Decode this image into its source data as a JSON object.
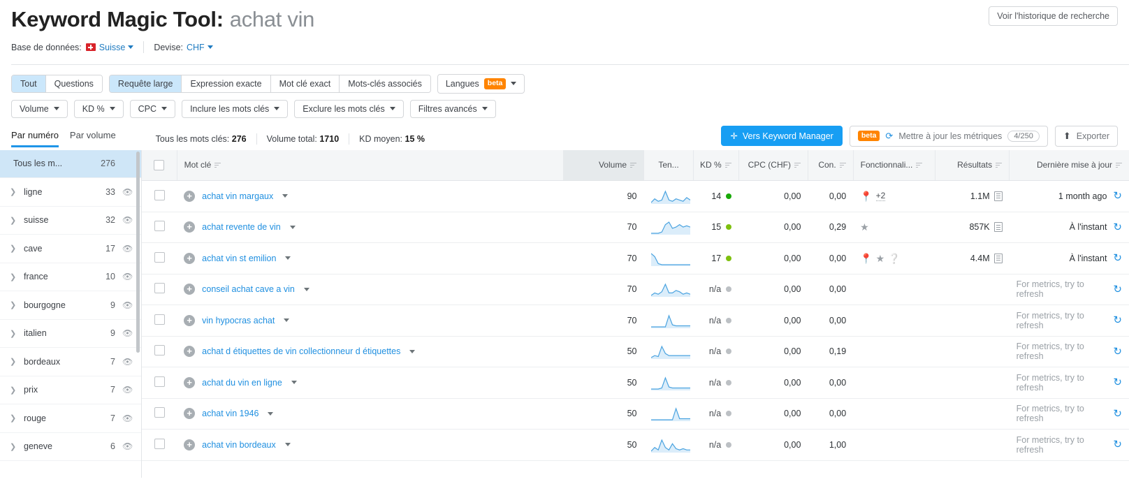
{
  "header": {
    "title_main": "Keyword Magic Tool:",
    "title_query": "achat vin",
    "history_button": "Voir l'historique de recherche",
    "database_label": "Base de données:",
    "database_value": "Suisse",
    "currency_label": "Devise:",
    "currency_value": "CHF"
  },
  "filters": {
    "match_tabs": [
      {
        "label": "Tout",
        "active": true
      },
      {
        "label": "Questions",
        "active": false
      }
    ],
    "type_tabs": [
      {
        "label": "Requête large",
        "active": true
      },
      {
        "label": "Expression exacte",
        "active": false
      },
      {
        "label": "Mot clé exact",
        "active": false
      },
      {
        "label": "Mots-clés associés",
        "active": false
      }
    ],
    "languages": {
      "label": "Langues",
      "badge": "beta"
    },
    "dropdowns": [
      {
        "label": "Volume"
      },
      {
        "label": "KD %"
      },
      {
        "label": "CPC"
      },
      {
        "label": "Inclure les mots clés"
      },
      {
        "label": "Exclure les mots clés"
      },
      {
        "label": "Filtres avancés"
      }
    ]
  },
  "summary": {
    "sort_tabs": [
      {
        "label": "Par numéro",
        "active": true
      },
      {
        "label": "Par volume",
        "active": false
      }
    ],
    "stats": [
      {
        "label": "Tous les mots clés:",
        "value": "276"
      },
      {
        "label": "Volume total:",
        "value": "1710"
      },
      {
        "label": "KD moyen:",
        "value": "15 %"
      }
    ],
    "keyword_manager_button": "Vers Keyword Manager",
    "update_metrics_button": "Mettre à jour les métriques",
    "update_metrics_badge": "beta",
    "update_metrics_quota": "4/250",
    "export_button": "Exporter"
  },
  "sidebar": {
    "all_label": "Tous les m...",
    "all_count": "276",
    "items": [
      {
        "label": "ligne",
        "count": "33"
      },
      {
        "label": "suisse",
        "count": "32"
      },
      {
        "label": "cave",
        "count": "17"
      },
      {
        "label": "france",
        "count": "10"
      },
      {
        "label": "bourgogne",
        "count": "9"
      },
      {
        "label": "italien",
        "count": "9"
      },
      {
        "label": "bordeaux",
        "count": "7"
      },
      {
        "label": "prix",
        "count": "7"
      },
      {
        "label": "rouge",
        "count": "7"
      },
      {
        "label": "geneve",
        "count": "6"
      }
    ]
  },
  "table": {
    "columns": [
      {
        "key": "keyword",
        "label": "Mot clé",
        "align": "left",
        "sortable": true,
        "sorted": false
      },
      {
        "key": "volume",
        "label": "Volume",
        "align": "right",
        "sortable": true,
        "sorted": true
      },
      {
        "key": "trend",
        "label": "Ten...",
        "align": "center",
        "sortable": false,
        "sorted": false
      },
      {
        "key": "kd",
        "label": "KD %",
        "align": "right",
        "sortable": true,
        "sorted": false
      },
      {
        "key": "cpc",
        "label": "CPC (CHF)",
        "align": "right",
        "sortable": true,
        "sorted": false
      },
      {
        "key": "con",
        "label": "Con.",
        "align": "right",
        "sortable": true,
        "sorted": false
      },
      {
        "key": "features",
        "label": "Fonctionnali...",
        "align": "left",
        "sortable": true,
        "sorted": false
      },
      {
        "key": "results",
        "label": "Résultats",
        "align": "right",
        "sortable": true,
        "sorted": false
      },
      {
        "key": "updated",
        "label": "Dernière mise à jour",
        "align": "right",
        "sortable": true,
        "sorted": false
      }
    ],
    "rows": [
      {
        "keyword": "achat vin margaux",
        "volume": "90",
        "trend": "3,6,4,5,12,5,4,6,5,4,7,5",
        "kd": "14",
        "kd_color": "#18a908",
        "cpc": "0,00",
        "con": "0,00",
        "features": [
          "location-pin-icon"
        ],
        "features_more": "+2",
        "results": "1.1M",
        "updated": "1 month ago",
        "updated_muted": false
      },
      {
        "keyword": "achat revente de vin",
        "volume": "70",
        "trend": "2,2,2,3,9,11,6,7,9,7,8,7",
        "kd": "15",
        "kd_color": "#7ec00e",
        "cpc": "0,00",
        "con": "0,29",
        "features": [
          "star-icon"
        ],
        "features_more": "",
        "results": "857K",
        "updated": "À l'instant",
        "updated_muted": false
      },
      {
        "keyword": "achat vin st emilion",
        "volume": "70",
        "trend": "14,11,4,3,3,3,3,3,3,3,3,3",
        "kd": "17",
        "kd_color": "#7ec00e",
        "cpc": "0,00",
        "con": "0,00",
        "features": [
          "location-pin-icon",
          "star-icon",
          "question-icon"
        ],
        "features_more": "",
        "results": "4.4M",
        "updated": "À l'instant",
        "updated_muted": false
      },
      {
        "keyword": "conseil achat cave a vin",
        "volume": "70",
        "trend": "3,5,4,6,12,5,5,7,6,4,5,4",
        "kd": "n/a",
        "kd_color": "#bcc0c4",
        "cpc": "0,00",
        "con": "0,00",
        "features": [],
        "features_more": "",
        "results": "",
        "updated": "For metrics, try to refresh",
        "updated_muted": true
      },
      {
        "keyword": "vin hypocras achat",
        "volume": "70",
        "trend": "2,2,2,2,2,13,4,3,3,3,3,3",
        "kd": "n/a",
        "kd_color": "#bcc0c4",
        "cpc": "0,00",
        "con": "0,00",
        "features": [],
        "features_more": "",
        "results": "",
        "updated": "For metrics, try to refresh",
        "updated_muted": true
      },
      {
        "keyword": "achat d étiquettes de vin collectionneur d étiquettes",
        "volume": "50",
        "trend": "2,4,3,13,6,4,4,4,4,4,4,4",
        "kd": "n/a",
        "kd_color": "#bcc0c4",
        "cpc": "0,00",
        "con": "0,19",
        "features": [],
        "features_more": "",
        "results": "",
        "updated": "For metrics, try to refresh",
        "updated_muted": true
      },
      {
        "keyword": "achat du vin en ligne",
        "volume": "50",
        "trend": "2,2,2,3,13,4,3,3,3,3,3,3",
        "kd": "n/a",
        "kd_color": "#bcc0c4",
        "cpc": "0,00",
        "con": "0,00",
        "features": [],
        "features_more": "",
        "results": "",
        "updated": "For metrics, try to refresh",
        "updated_muted": true
      },
      {
        "keyword": "achat vin 1946",
        "volume": "50",
        "trend": "2,2,2,2,2,2,2,13,3,3,3,3",
        "kd": "n/a",
        "kd_color": "#bcc0c4",
        "cpc": "0,00",
        "con": "0,00",
        "features": [],
        "features_more": "",
        "results": "",
        "updated": "For metrics, try to refresh",
        "updated_muted": true
      },
      {
        "keyword": "achat vin bordeaux",
        "volume": "50",
        "trend": "3,6,4,12,6,4,9,5,4,5,4,4",
        "kd": "n/a",
        "kd_color": "#bcc0c4",
        "cpc": "0,00",
        "con": "1,00",
        "features": [],
        "features_more": "",
        "results": "",
        "updated": "For metrics, try to refresh",
        "updated_muted": true
      }
    ]
  }
}
